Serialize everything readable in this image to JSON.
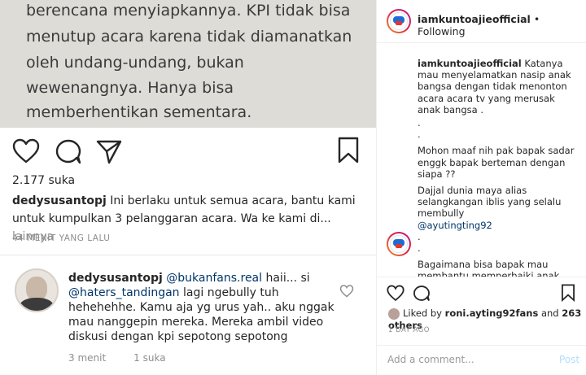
{
  "photo": {
    "lines": [
      "berencana menyiapkannya. KPI tidak bisa",
      "menutup acara karena tidak diamanatkan",
      "oleh undang-undang, bukan",
      "wewenangnya. Hanya bisa",
      "memberhentikan sementara."
    ]
  },
  "left": {
    "likes": "2.177 suka",
    "caption": {
      "user": "dedysusantopj",
      "text": " Ini berlaku untuk semua acara, bantu kami untuk kumpulkan 3 pelanggaran acara. Wa ke kami di...",
      "more": " lainnya"
    },
    "ago": "44 MENIT YANG LALU",
    "comment": {
      "user": "dedysusantopj",
      "mention1": "@bukanfans.real",
      "text1": " haii... si ",
      "mention2": "@haters_tandingan",
      "text2": " lagi ngebully tuh hehehehhe. Kamu aja yg urus yah.. aku nggak mau nanggepin mereka. Mereka ambil video diskusi dengan kpi sepotong sepotong",
      "time": "3 menit",
      "likes": "1 suka"
    }
  },
  "right": {
    "header": {
      "username": "iamkuntoajieofficial",
      "separator": " • ",
      "follow_state": "Following"
    },
    "caption": {
      "user": "iamkuntoajieofficial",
      "text": " Katanya mau menyelamatkan nasip anak bangsa dengan tidak menonton acara acara tv yang merusak anak bangsa ."
    },
    "dots": [
      ".",
      "."
    ],
    "paragraph1": "Mohon maaf nih pak bapak sadar enggk bapak berteman dengan siapa ??",
    "paragraph2": "Dajjal dunia maya alias selangkangan iblis yang selalu membully",
    "mention": "@ayutingting92",
    "dots2": [
      ".",
      "."
    ],
    "paragraph3": "Bagaimana bisa bapak mau membantu memperbaiki anak bangsa Sedangkan bapak bergaul dan berteman dengan orang yang kerjaan mendoktrin orang orang untuk",
    "liked_by": {
      "prefix": "Liked by ",
      "user": "roni.ayting92fans",
      "suffix": " and ",
      "others": "263 others"
    },
    "ago": "1 DAY AGO",
    "add_comment_placeholder": "Add a comment...",
    "post_label": "Post"
  }
}
